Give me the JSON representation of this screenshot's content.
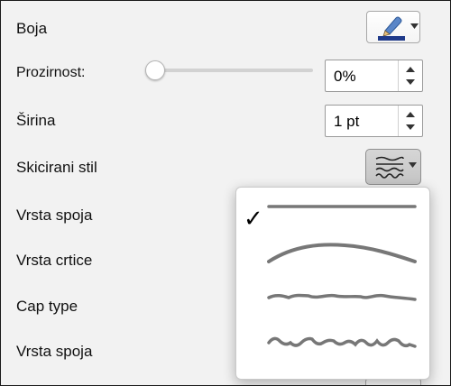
{
  "labels": {
    "color": "Boja",
    "transparency": "Prozirnost:",
    "width": "Širina",
    "sketch_style": "Skicirani stil",
    "join_type_1": "Vrsta spoja",
    "dash_type": "Vrsta crtice",
    "cap_type": "Cap type",
    "join_type_2": "Vrsta spoja"
  },
  "transparency": {
    "value": "0%",
    "slider_value_percent": 0
  },
  "width": {
    "value": "1 pt"
  },
  "color": {
    "swatch_color": "#1f3a8a",
    "icon": "pen-icon"
  },
  "sketch_style": {
    "icon": "sketch-squiggle-icon",
    "options": [
      {
        "name": "none",
        "selected": true
      },
      {
        "name": "curved",
        "selected": false
      },
      {
        "name": "freehand",
        "selected": false
      },
      {
        "name": "scribble",
        "selected": false
      }
    ],
    "check_glyph": "✓"
  }
}
